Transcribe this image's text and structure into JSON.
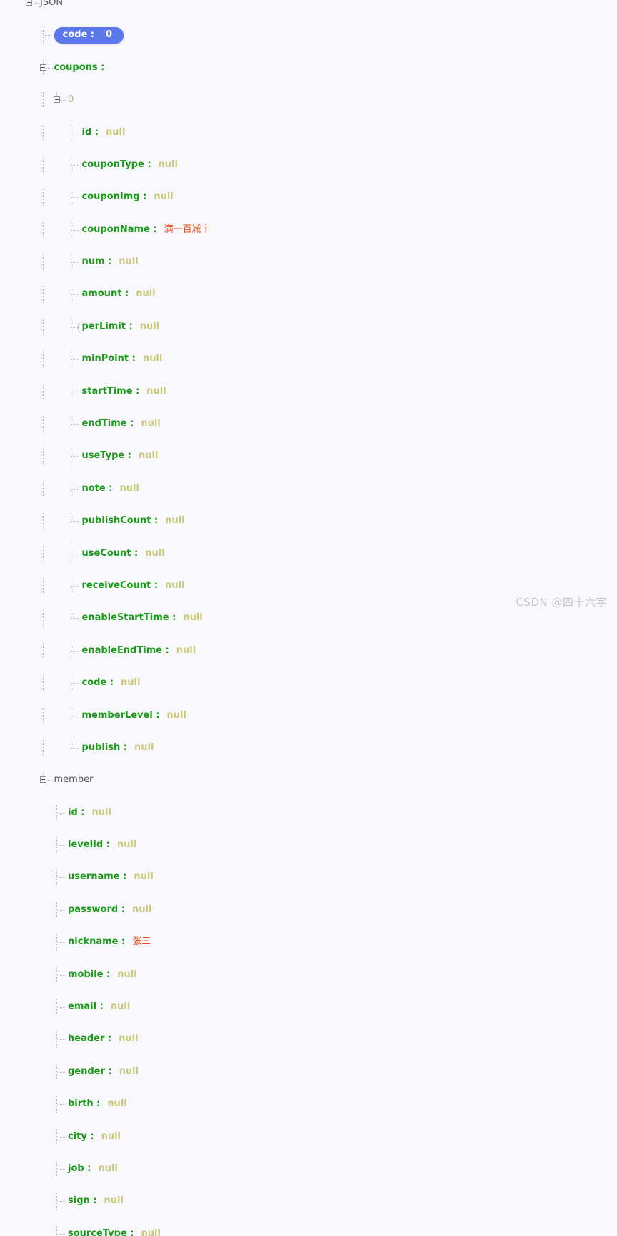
{
  "viewer": {
    "background_color": "#f9f8fd",
    "key_color": "#1a9b18",
    "null_color": "#c9c97a",
    "string_color": "#ee4c1e",
    "object_color": "#55555f",
    "index_color": "#b4b48a",
    "selection_color": "#5b78ea",
    "root_label": "JSON"
  },
  "watermark": {
    "text": "CSDN @四十六字"
  },
  "tree": {
    "root": {
      "label": "JSON",
      "expander": "minus"
    },
    "rows": [
      {
        "id": "root",
        "depth": 0,
        "type": "root",
        "label": "JSON",
        "value": null,
        "expander": "minus",
        "last": false,
        "selected": false
      },
      {
        "id": "code",
        "depth": 1,
        "type": "number",
        "label": "code",
        "value": "0",
        "expander": "none",
        "last": false,
        "selected": true
      },
      {
        "id": "coupons",
        "depth": 1,
        "type": "object",
        "label": "coupons",
        "value": null,
        "expander": "minus",
        "last": false,
        "selected": false
      },
      {
        "id": "coupons.0",
        "depth": 2,
        "type": "index",
        "label": "0",
        "value": null,
        "expander": "minus",
        "last": true,
        "selected": false
      },
      {
        "id": "id",
        "depth": 3,
        "type": "null",
        "label": "id",
        "value": "null",
        "expander": "none",
        "last": false,
        "selected": false
      },
      {
        "id": "couponType",
        "depth": 3,
        "type": "null",
        "label": "couponType",
        "value": "null",
        "expander": "none",
        "last": false,
        "selected": false
      },
      {
        "id": "couponImg",
        "depth": 3,
        "type": "null",
        "label": "couponImg",
        "value": "null",
        "expander": "none",
        "last": false,
        "selected": false
      },
      {
        "id": "couponName",
        "depth": 3,
        "type": "string",
        "label": "couponName",
        "value": "满一百减十",
        "expander": "none",
        "last": false,
        "selected": false
      },
      {
        "id": "num",
        "depth": 3,
        "type": "null",
        "label": "num",
        "value": "null",
        "expander": "none",
        "last": false,
        "selected": false
      },
      {
        "id": "amount",
        "depth": 3,
        "type": "null",
        "label": "amount",
        "value": "null",
        "expander": "none",
        "last": false,
        "selected": false
      },
      {
        "id": "perLimit",
        "depth": 3,
        "type": "null",
        "label": "perLimit",
        "value": "null",
        "expander": "none",
        "last": false,
        "selected": false,
        "caret": true
      },
      {
        "id": "minPoint",
        "depth": 3,
        "type": "null",
        "label": "minPoint",
        "value": "null",
        "expander": "none",
        "last": false,
        "selected": false
      },
      {
        "id": "startTime",
        "depth": 3,
        "type": "null",
        "label": "startTime",
        "value": "null",
        "expander": "none",
        "last": false,
        "selected": false
      },
      {
        "id": "endTime",
        "depth": 3,
        "type": "null",
        "label": "endTime",
        "value": "null",
        "expander": "none",
        "last": false,
        "selected": false
      },
      {
        "id": "useType",
        "depth": 3,
        "type": "null",
        "label": "useType",
        "value": "null",
        "expander": "none",
        "last": false,
        "selected": false
      },
      {
        "id": "note",
        "depth": 3,
        "type": "null",
        "label": "note",
        "value": "null",
        "expander": "none",
        "last": false,
        "selected": false
      },
      {
        "id": "publishCount",
        "depth": 3,
        "type": "null",
        "label": "publishCount",
        "value": "null",
        "expander": "none",
        "last": false,
        "selected": false
      },
      {
        "id": "useCount",
        "depth": 3,
        "type": "null",
        "label": "useCount",
        "value": "null",
        "expander": "none",
        "last": false,
        "selected": false
      },
      {
        "id": "receiveCount",
        "depth": 3,
        "type": "null",
        "label": "receiveCount",
        "value": "null",
        "expander": "none",
        "last": false,
        "selected": false
      },
      {
        "id": "enableStartTime",
        "depth": 3,
        "type": "null",
        "label": "enableStartTime",
        "value": "null",
        "expander": "none",
        "last": false,
        "selected": false
      },
      {
        "id": "enableEndTime",
        "depth": 3,
        "type": "null",
        "label": "enableEndTime",
        "value": "null",
        "expander": "none",
        "last": false,
        "selected": false
      },
      {
        "id": "coupon.code",
        "depth": 3,
        "type": "null",
        "label": "code",
        "value": "null",
        "expander": "none",
        "last": false,
        "selected": false
      },
      {
        "id": "memberLevel",
        "depth": 3,
        "type": "null",
        "label": "memberLevel",
        "value": "null",
        "expander": "none",
        "last": false,
        "selected": false
      },
      {
        "id": "publish",
        "depth": 3,
        "type": "null",
        "label": "publish",
        "value": "null",
        "expander": "none",
        "last": true,
        "selected": false
      },
      {
        "id": "member",
        "depth": 1,
        "type": "object",
        "label": "member",
        "value": null,
        "expander": "minus",
        "last": true,
        "selected": false,
        "nocolon": true
      },
      {
        "id": "m.id",
        "depth": 2,
        "type": "null",
        "label": "id",
        "value": "null",
        "expander": "none",
        "last": false,
        "selected": false
      },
      {
        "id": "m.levelId",
        "depth": 2,
        "type": "null",
        "label": "levelId",
        "value": "null",
        "expander": "none",
        "last": false,
        "selected": false
      },
      {
        "id": "m.username",
        "depth": 2,
        "type": "null",
        "label": "username",
        "value": "null",
        "expander": "none",
        "last": false,
        "selected": false
      },
      {
        "id": "m.password",
        "depth": 2,
        "type": "null",
        "label": "password",
        "value": "null",
        "expander": "none",
        "last": false,
        "selected": false
      },
      {
        "id": "m.nickname",
        "depth": 2,
        "type": "string",
        "label": "nickname",
        "value": "张三",
        "expander": "none",
        "last": false,
        "selected": false
      },
      {
        "id": "m.mobile",
        "depth": 2,
        "type": "null",
        "label": "mobile",
        "value": "null",
        "expander": "none",
        "last": false,
        "selected": false
      },
      {
        "id": "m.email",
        "depth": 2,
        "type": "null",
        "label": "email",
        "value": "null",
        "expander": "none",
        "last": false,
        "selected": false
      },
      {
        "id": "m.header",
        "depth": 2,
        "type": "null",
        "label": "header",
        "value": "null",
        "expander": "none",
        "last": false,
        "selected": false
      },
      {
        "id": "m.gender",
        "depth": 2,
        "type": "null",
        "label": "gender",
        "value": "null",
        "expander": "none",
        "last": false,
        "selected": false
      },
      {
        "id": "m.birth",
        "depth": 2,
        "type": "null",
        "label": "birth",
        "value": "null",
        "expander": "none",
        "last": false,
        "selected": false
      },
      {
        "id": "m.city",
        "depth": 2,
        "type": "null",
        "label": "city",
        "value": "null",
        "expander": "none",
        "last": false,
        "selected": false
      },
      {
        "id": "m.job",
        "depth": 2,
        "type": "null",
        "label": "job",
        "value": "null",
        "expander": "none",
        "last": false,
        "selected": false
      },
      {
        "id": "m.sign",
        "depth": 2,
        "type": "null",
        "label": "sign",
        "value": "null",
        "expander": "none",
        "last": false,
        "selected": false
      },
      {
        "id": "m.sourceType",
        "depth": 2,
        "type": "null",
        "label": "sourceType",
        "value": "null",
        "expander": "none",
        "last": false,
        "selected": false
      }
    ]
  }
}
